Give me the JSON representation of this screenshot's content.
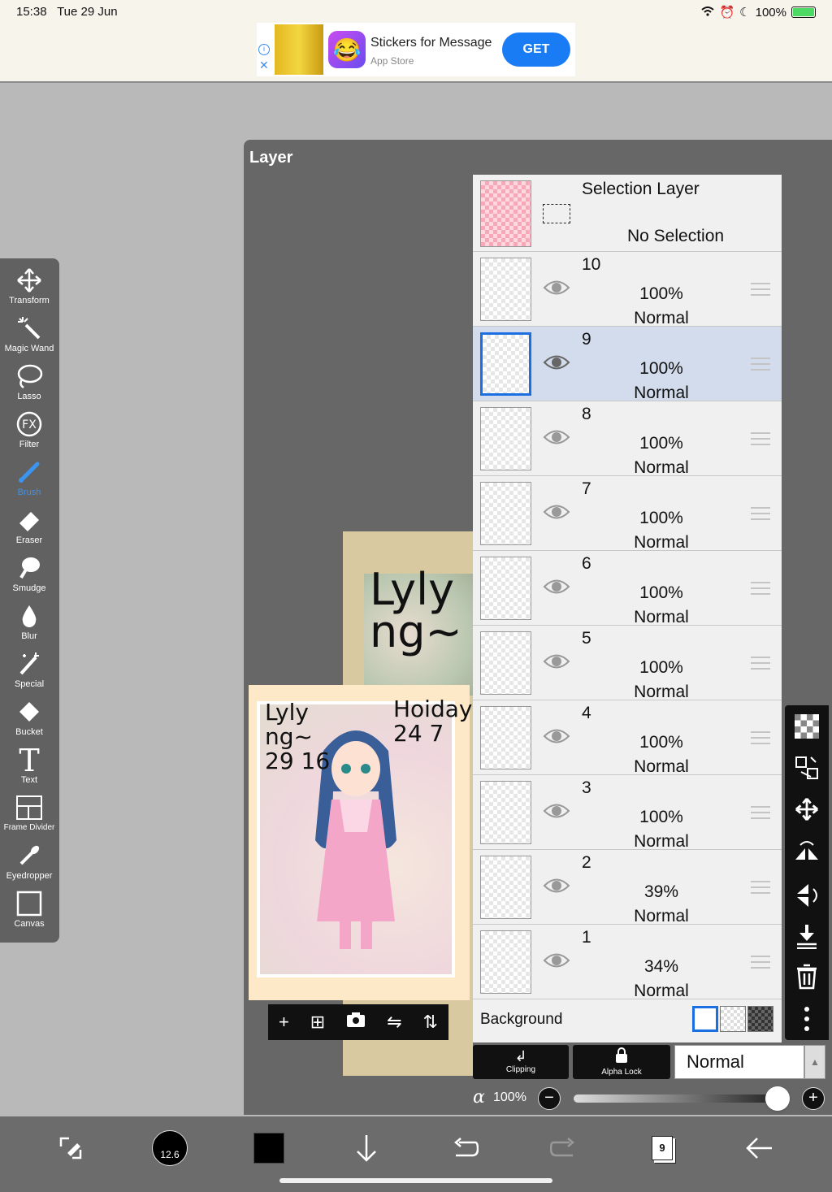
{
  "status": {
    "time": "15:38",
    "date": "Tue 29 Jun",
    "battery": "100%"
  },
  "ad": {
    "title": "Stickers for Message",
    "subtitle": "App Store",
    "button": "GET"
  },
  "panel": {
    "title": "Layer"
  },
  "tools": [
    {
      "label": "Transform",
      "icon": "move-arrows"
    },
    {
      "label": "Magic Wand",
      "icon": "magic-wand"
    },
    {
      "label": "Lasso",
      "icon": "lasso"
    },
    {
      "label": "Filter",
      "icon": "fx"
    },
    {
      "label": "Brush",
      "icon": "brush",
      "active": true
    },
    {
      "label": "Eraser",
      "icon": "eraser"
    },
    {
      "label": "Smudge",
      "icon": "smudge"
    },
    {
      "label": "Blur",
      "icon": "drop"
    },
    {
      "label": "Special",
      "icon": "sparkle-pen"
    },
    {
      "label": "Bucket",
      "icon": "bucket"
    },
    {
      "label": "Text",
      "icon": "text-t"
    },
    {
      "label": "Frame Divider",
      "icon": "frame"
    },
    {
      "label": "Eyedropper",
      "icon": "eyedropper"
    },
    {
      "label": "Canvas",
      "icon": "canvas"
    }
  ],
  "selection_layer": {
    "name": "Selection Layer",
    "state": "No Selection"
  },
  "layers": [
    {
      "number": "10",
      "opacity": "100%",
      "blend": "Normal",
      "selected": false
    },
    {
      "number": "9",
      "opacity": "100%",
      "blend": "Normal",
      "selected": true
    },
    {
      "number": "8",
      "opacity": "100%",
      "blend": "Normal",
      "selected": false
    },
    {
      "number": "7",
      "opacity": "100%",
      "blend": "Normal",
      "selected": false
    },
    {
      "number": "6",
      "opacity": "100%",
      "blend": "Normal",
      "selected": false
    },
    {
      "number": "5",
      "opacity": "100%",
      "blend": "Normal",
      "selected": false
    },
    {
      "number": "4",
      "opacity": "100%",
      "blend": "Normal",
      "selected": false
    },
    {
      "number": "3",
      "opacity": "100%",
      "blend": "Normal",
      "selected": false
    },
    {
      "number": "2",
      "opacity": "39%",
      "blend": "Normal",
      "selected": false
    },
    {
      "number": "1",
      "opacity": "34%",
      "blend": "Normal",
      "selected": false
    }
  ],
  "background": {
    "label": "Background"
  },
  "bottom_panel": {
    "clipping": "Clipping",
    "alpha_lock": "Alpha Lock",
    "blend_mode": "Normal",
    "alpha_symbol": "α",
    "alpha_value": "100%"
  },
  "artwork": {
    "text_left": "Lyly\nng~\n29 16",
    "text_right": "Hoiday\n24 7",
    "text_back": "Lyly\nng~"
  },
  "toolbar": {
    "brush_size": "12.6",
    "page_number": "9"
  }
}
